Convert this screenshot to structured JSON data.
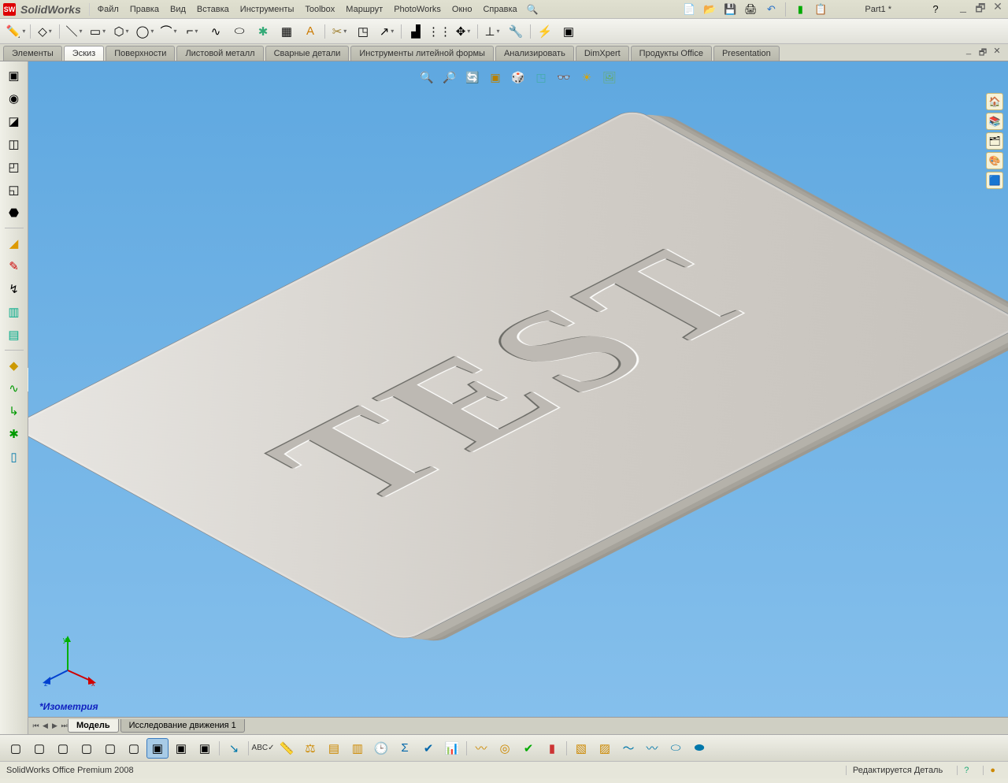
{
  "app_title": "SolidWorks",
  "menu": [
    "Файл",
    "Правка",
    "Вид",
    "Вставка",
    "Инструменты",
    "Toolbox",
    "Маршрут",
    "PhotoWorks",
    "Окно",
    "Справка"
  ],
  "document_name": "Part1 *",
  "quick_access": {
    "new": "new",
    "open": "open",
    "save": "save",
    "print": "print",
    "undo": "undo",
    "rebuild": "rebuild",
    "options": "options"
  },
  "tabs": {
    "items": [
      "Элементы",
      "Эскиз",
      "Поверхности",
      "Листовой металл",
      "Сварные детали",
      "Инструменты литейной формы",
      "Анализировать",
      "DimXpert",
      "Продукты Office",
      "Presentation"
    ],
    "active_index": 1
  },
  "bottom_tabs": {
    "items": [
      "Модель",
      "Исследование движения 1"
    ],
    "active_index": 0
  },
  "viewport": {
    "label": "*Изометрия",
    "engraved_text": "TEST",
    "origin_axes": {
      "x": "x",
      "y": "y",
      "z": "z"
    }
  },
  "status": {
    "left": "SolidWorks Office Premium 2008",
    "right": "Редактируется Деталь"
  },
  "help_symbol": "?"
}
